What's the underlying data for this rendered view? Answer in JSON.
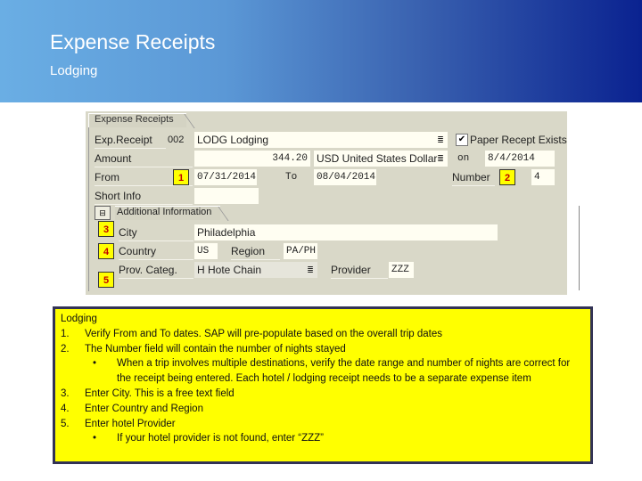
{
  "header": {
    "title": "Expense Receipts",
    "subtitle": "Lodging"
  },
  "sap_form": {
    "tab_label": "Expense Receipts",
    "exp_receipt": {
      "label": "Exp.Receipt",
      "code": "002",
      "value": "LODG Lodging"
    },
    "amount": {
      "label": "Amount",
      "value": "344.20",
      "currency": "USD United States Dollar"
    },
    "paper_receipt": {
      "label": "Paper Recept Exists",
      "checked": true,
      "check_glyph": "✔"
    },
    "on": {
      "label": "on",
      "value": "8/4/2014"
    },
    "from": {
      "label": "From",
      "value": "07/31/2014"
    },
    "to": {
      "label": "To",
      "value": "08/04/2014"
    },
    "number": {
      "label": "Number",
      "value": "4"
    },
    "short_info": {
      "label": "Short Info",
      "value": ""
    },
    "additional_info_tab": "Additional Information",
    "city": {
      "label": "City",
      "value": "Philadelphia"
    },
    "country": {
      "label": "Country",
      "value": "US"
    },
    "region": {
      "label": "Region",
      "value": "PA/PH"
    },
    "prov_categ": {
      "label": "Prov. Categ.",
      "value": "H Hote Chain"
    },
    "provider": {
      "label": "Provider",
      "value": "ZZZ"
    },
    "dropdown_glyph": "≣",
    "collapse_glyph": "⊟",
    "badges": [
      "1",
      "2",
      "3",
      "4",
      "5"
    ]
  },
  "notes": {
    "heading": "Lodging",
    "items": [
      {
        "num": "1.",
        "text": "Verify From and To dates. SAP will pre-populate based on the overall trip dates"
      },
      {
        "num": "2.",
        "text": "The Number field will contain the number of nights stayed",
        "bullets": [
          "When a trip involves multiple destinations, verify the date range and number of nights are correct for the receipt being entered. Each hotel / lodging receipt needs to be a separate expense item"
        ]
      },
      {
        "num": "3.",
        "text": "Enter City. This is a free text field"
      },
      {
        "num": "4.",
        "text": "Enter Country and Region"
      },
      {
        "num": "5.",
        "text": "Enter hotel Provider",
        "bullets": [
          "If your hotel provider is not found, enter “ZZZ”"
        ]
      }
    ],
    "bullet_glyph": "•"
  }
}
